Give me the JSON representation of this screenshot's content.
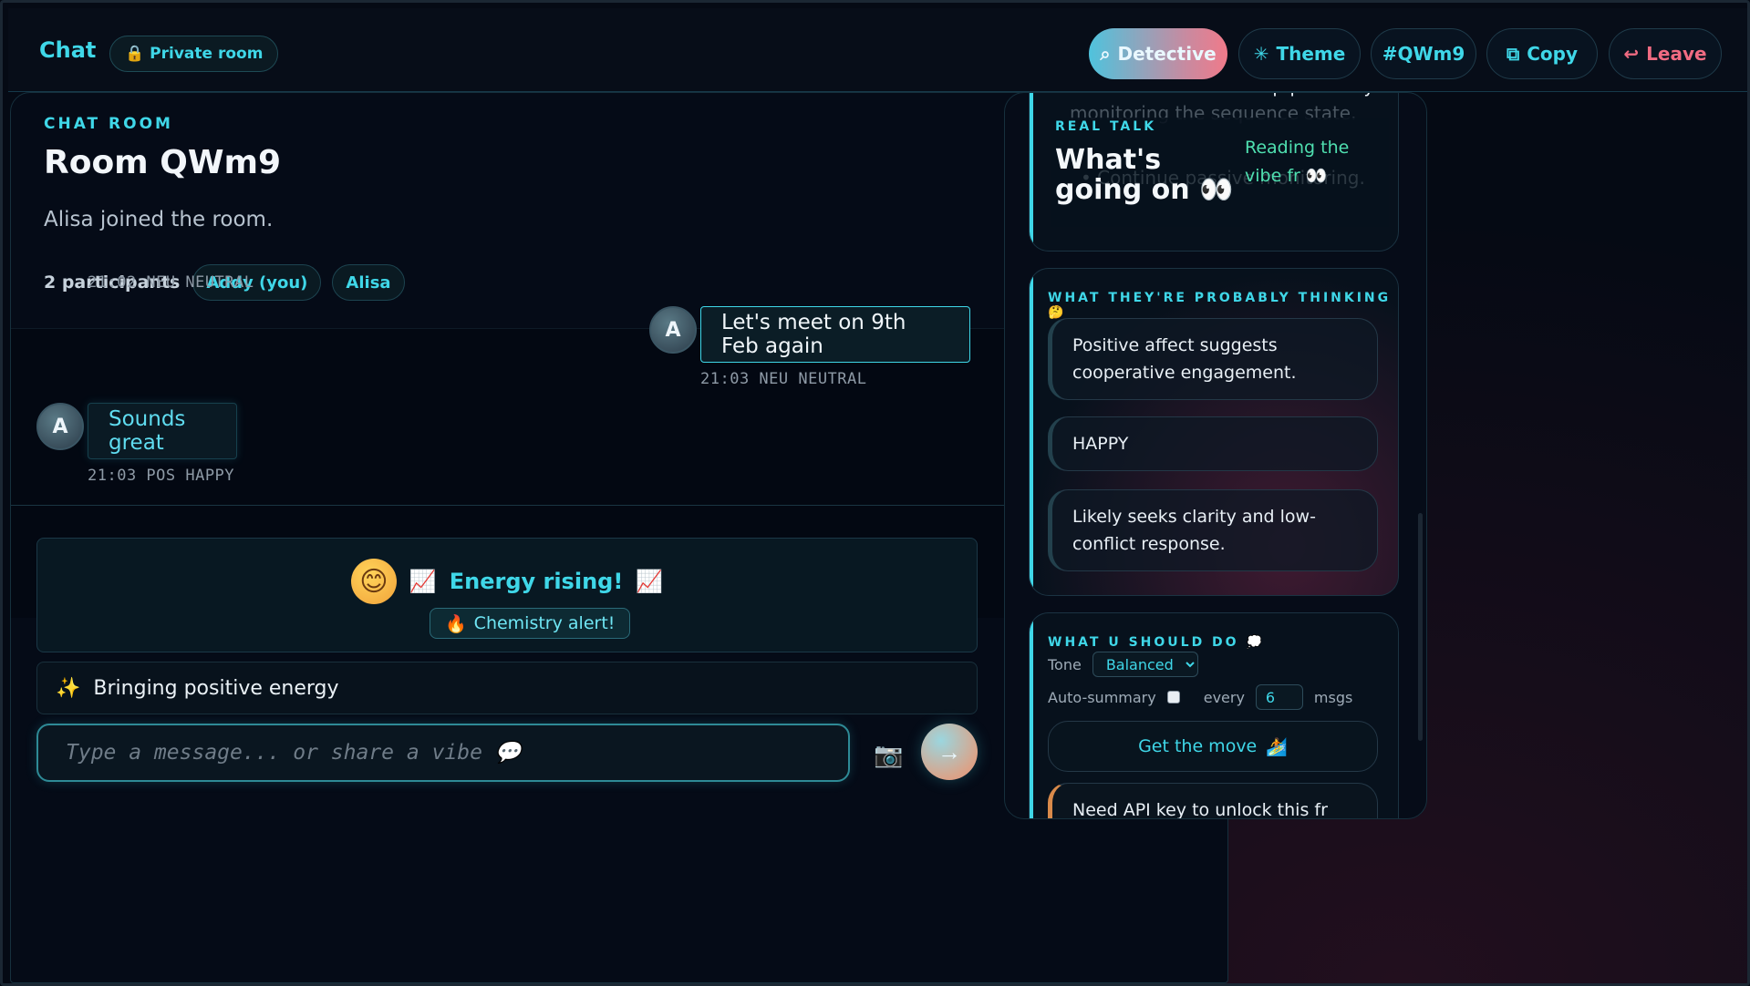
{
  "header": {
    "brand": "Chat",
    "private_label": "Private room",
    "buttons": {
      "detective": "Detective",
      "theme": "Theme",
      "room_code": "#QWm9",
      "copy": "Copy",
      "leave": "Leave"
    }
  },
  "room": {
    "kicker": "CHAT ROOM",
    "title": "Room QWm9",
    "subtitle": "Alisa joined the room.",
    "participant_count": "2 participants",
    "participants": [
      "Addy (you)",
      "Alisa"
    ]
  },
  "messages": [
    {
      "meta": "21:02  NEU NEUTRAL"
    },
    {
      "from": "me",
      "avatar": "A",
      "text": "Let's meet on 9th Feb again",
      "meta": "21:03  NEU NEUTRAL"
    },
    {
      "from": "them",
      "avatar": "A",
      "text": "Sounds great",
      "meta": "21:03  POS HAPPY"
    }
  ],
  "energy": {
    "emoji": "😊",
    "text": "Energy rising!",
    "chart_icon": "📈",
    "chemistry": "Chemistry alert!",
    "fire_icon": "🔥"
  },
  "vibe_bar": {
    "icon": "✨",
    "text": "Bringing positive energy"
  },
  "composer": {
    "placeholder": "Type a message... or share a vibe 💬",
    "camera_icon": "📷",
    "send_icon": "→"
  },
  "right": {
    "faded_line1": "communication. • Keep passively",
    "faded_line2": "monitoring the sequence state.",
    "faded_line3": "• Continue passive monitoring.",
    "real_talk": {
      "kicker": "REAL TALK",
      "title": "What's going on 👀",
      "side": "Reading the vibe fr 👀"
    },
    "thinking": {
      "kicker": "WHAT THEY'RE PROBABLY THINKING 🤔",
      "items": [
        "Positive affect suggests cooperative engagement.",
        "HAPPY",
        "Likely seeks clarity and low-conflict response."
      ]
    },
    "do": {
      "kicker": "WHAT U SHOULD DO 💭",
      "tone_label": "Tone",
      "tone_value": "Balanced",
      "auto_summary_label": "Auto-summary",
      "every_label": "every",
      "every_value": "6",
      "msgs_label": "msgs",
      "move_button": "Get the move",
      "move_icon": "🏄",
      "api_text": "Need API key to unlock this fr"
    }
  }
}
